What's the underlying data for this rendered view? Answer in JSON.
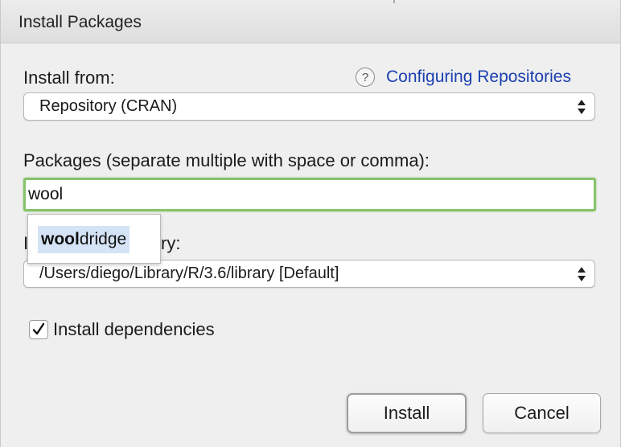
{
  "window": {
    "title": "Install Packages"
  },
  "install_from": {
    "label": "Install from:",
    "selected": "Repository (CRAN)",
    "help_icon": "question-mark-icon",
    "help_link_text": "Configuring Repositories"
  },
  "packages": {
    "label": "Packages (separate multiple with space or comma):",
    "value": "wool",
    "autocomplete": {
      "match": "wool",
      "rest": "dridge"
    }
  },
  "library": {
    "label_partial_left": "I",
    "label_partial_right": "ry:",
    "selected": "/Users/diego/Library/R/3.6/library [Default]"
  },
  "dependencies": {
    "label": "Install dependencies",
    "checked": true
  },
  "buttons": {
    "install_label": "Install",
    "cancel_label": "Cancel"
  },
  "colors": {
    "link": "#1a3fb0",
    "focus_ring": "#86c46a",
    "suggestion_highlight": "#d4e3f5"
  }
}
